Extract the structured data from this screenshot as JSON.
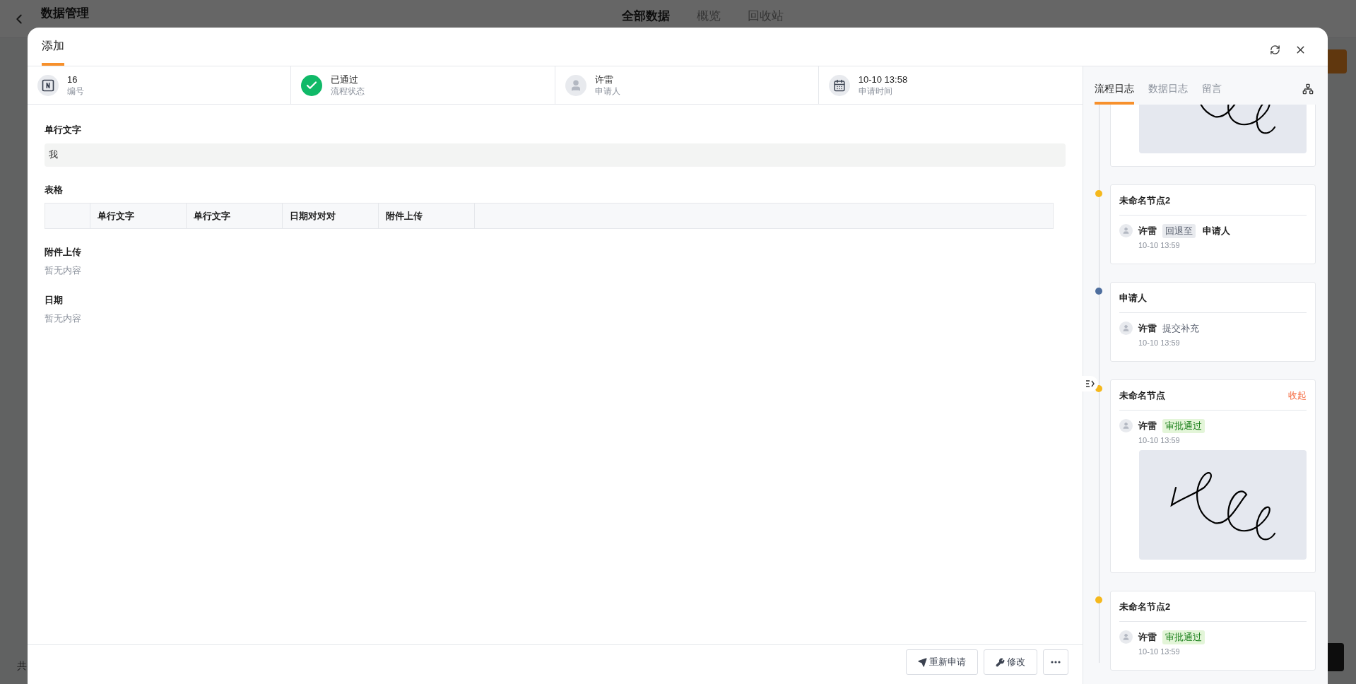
{
  "background": {
    "title": "数据管理",
    "tabs": [
      {
        "label": "全部数据",
        "selected": true
      },
      {
        "label": "概览",
        "selected": false
      },
      {
        "label": "回收站",
        "selected": false
      }
    ],
    "footer_fragment": "共"
  },
  "dialog": {
    "tabs": [
      {
        "label": "添加",
        "selected": true
      }
    ],
    "summary": [
      {
        "kind": "number",
        "value": "16",
        "label": "编号"
      },
      {
        "kind": "status",
        "value": "已通过",
        "label": "流程状态"
      },
      {
        "kind": "person",
        "value": "许雷",
        "label": "申请人"
      },
      {
        "kind": "date",
        "value": "10-10 13:58",
        "label": "申请时间"
      }
    ],
    "fields": [
      {
        "kind": "text",
        "label": "单行文字",
        "value": "我"
      },
      {
        "kind": "table",
        "label": "表格",
        "columns": [
          "单行文字",
          "单行文字",
          "日期对对对",
          "附件上传"
        ]
      },
      {
        "kind": "empty",
        "label": "附件上传",
        "value": "暂无内容"
      },
      {
        "kind": "empty",
        "label": "日期",
        "value": "暂无内容"
      }
    ],
    "footer_buttons": [
      {
        "kind": "send",
        "label": "重新申请"
      },
      {
        "kind": "edit",
        "label": "修改"
      },
      {
        "kind": "more"
      }
    ]
  },
  "side_panel": {
    "tabs": [
      {
        "label": "流程日志",
        "selected": true
      },
      {
        "label": "数据日志",
        "selected": false
      },
      {
        "label": "留言",
        "selected": false
      }
    ],
    "timeline": [
      {
        "kind": "partial",
        "signature": true
      },
      {
        "kind": "node",
        "title": "未命名节点2",
        "color": "#f5b81c",
        "person": "许雷",
        "action": {
          "kind": "gray",
          "label": "回退至"
        },
        "target": "申请人",
        "time": "10-10 13:59",
        "signature": false
      },
      {
        "kind": "node",
        "title": "申请人",
        "color": "#4e6e9e",
        "person": "许雷",
        "action": {
          "kind": "plain",
          "label": "提交补充"
        },
        "time": "10-10 13:59",
        "signature": false
      },
      {
        "kind": "node",
        "title": "未命名节点",
        "color": "#f5b81c",
        "collapse_label": "收起",
        "person": "许雷",
        "action": {
          "kind": "green",
          "label": "审批通过"
        },
        "time": "10-10 13:59",
        "signature": true
      },
      {
        "kind": "node",
        "title": "未命名节点2",
        "color": "#f5b81c",
        "person": "许雷",
        "action": {
          "kind": "green",
          "label": "审批通过"
        },
        "time": "10-10 13:59",
        "signature": false
      }
    ]
  }
}
